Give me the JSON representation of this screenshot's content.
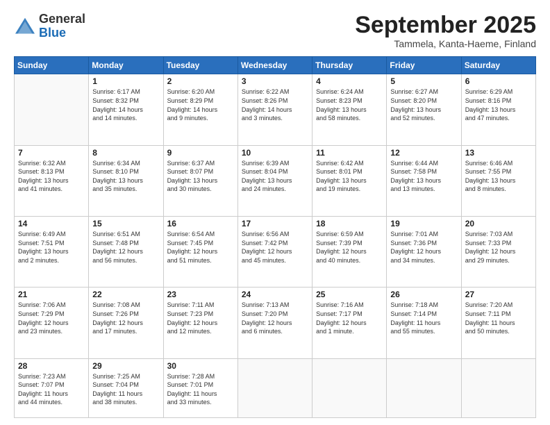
{
  "header": {
    "logo_general": "General",
    "logo_blue": "Blue",
    "month": "September 2025",
    "location": "Tammela, Kanta-Haeme, Finland"
  },
  "weekdays": [
    "Sunday",
    "Monday",
    "Tuesday",
    "Wednesday",
    "Thursday",
    "Friday",
    "Saturday"
  ],
  "weeks": [
    [
      {
        "day": "",
        "info": ""
      },
      {
        "day": "1",
        "info": "Sunrise: 6:17 AM\nSunset: 8:32 PM\nDaylight: 14 hours\nand 14 minutes."
      },
      {
        "day": "2",
        "info": "Sunrise: 6:20 AM\nSunset: 8:29 PM\nDaylight: 14 hours\nand 9 minutes."
      },
      {
        "day": "3",
        "info": "Sunrise: 6:22 AM\nSunset: 8:26 PM\nDaylight: 14 hours\nand 3 minutes."
      },
      {
        "day": "4",
        "info": "Sunrise: 6:24 AM\nSunset: 8:23 PM\nDaylight: 13 hours\nand 58 minutes."
      },
      {
        "day": "5",
        "info": "Sunrise: 6:27 AM\nSunset: 8:20 PM\nDaylight: 13 hours\nand 52 minutes."
      },
      {
        "day": "6",
        "info": "Sunrise: 6:29 AM\nSunset: 8:16 PM\nDaylight: 13 hours\nand 47 minutes."
      }
    ],
    [
      {
        "day": "7",
        "info": "Sunrise: 6:32 AM\nSunset: 8:13 PM\nDaylight: 13 hours\nand 41 minutes."
      },
      {
        "day": "8",
        "info": "Sunrise: 6:34 AM\nSunset: 8:10 PM\nDaylight: 13 hours\nand 35 minutes."
      },
      {
        "day": "9",
        "info": "Sunrise: 6:37 AM\nSunset: 8:07 PM\nDaylight: 13 hours\nand 30 minutes."
      },
      {
        "day": "10",
        "info": "Sunrise: 6:39 AM\nSunset: 8:04 PM\nDaylight: 13 hours\nand 24 minutes."
      },
      {
        "day": "11",
        "info": "Sunrise: 6:42 AM\nSunset: 8:01 PM\nDaylight: 13 hours\nand 19 minutes."
      },
      {
        "day": "12",
        "info": "Sunrise: 6:44 AM\nSunset: 7:58 PM\nDaylight: 13 hours\nand 13 minutes."
      },
      {
        "day": "13",
        "info": "Sunrise: 6:46 AM\nSunset: 7:55 PM\nDaylight: 13 hours\nand 8 minutes."
      }
    ],
    [
      {
        "day": "14",
        "info": "Sunrise: 6:49 AM\nSunset: 7:51 PM\nDaylight: 13 hours\nand 2 minutes."
      },
      {
        "day": "15",
        "info": "Sunrise: 6:51 AM\nSunset: 7:48 PM\nDaylight: 12 hours\nand 56 minutes."
      },
      {
        "day": "16",
        "info": "Sunrise: 6:54 AM\nSunset: 7:45 PM\nDaylight: 12 hours\nand 51 minutes."
      },
      {
        "day": "17",
        "info": "Sunrise: 6:56 AM\nSunset: 7:42 PM\nDaylight: 12 hours\nand 45 minutes."
      },
      {
        "day": "18",
        "info": "Sunrise: 6:59 AM\nSunset: 7:39 PM\nDaylight: 12 hours\nand 40 minutes."
      },
      {
        "day": "19",
        "info": "Sunrise: 7:01 AM\nSunset: 7:36 PM\nDaylight: 12 hours\nand 34 minutes."
      },
      {
        "day": "20",
        "info": "Sunrise: 7:03 AM\nSunset: 7:33 PM\nDaylight: 12 hours\nand 29 minutes."
      }
    ],
    [
      {
        "day": "21",
        "info": "Sunrise: 7:06 AM\nSunset: 7:29 PM\nDaylight: 12 hours\nand 23 minutes."
      },
      {
        "day": "22",
        "info": "Sunrise: 7:08 AM\nSunset: 7:26 PM\nDaylight: 12 hours\nand 17 minutes."
      },
      {
        "day": "23",
        "info": "Sunrise: 7:11 AM\nSunset: 7:23 PM\nDaylight: 12 hours\nand 12 minutes."
      },
      {
        "day": "24",
        "info": "Sunrise: 7:13 AM\nSunset: 7:20 PM\nDaylight: 12 hours\nand 6 minutes."
      },
      {
        "day": "25",
        "info": "Sunrise: 7:16 AM\nSunset: 7:17 PM\nDaylight: 12 hours\nand 1 minute."
      },
      {
        "day": "26",
        "info": "Sunrise: 7:18 AM\nSunset: 7:14 PM\nDaylight: 11 hours\nand 55 minutes."
      },
      {
        "day": "27",
        "info": "Sunrise: 7:20 AM\nSunset: 7:11 PM\nDaylight: 11 hours\nand 50 minutes."
      }
    ],
    [
      {
        "day": "28",
        "info": "Sunrise: 7:23 AM\nSunset: 7:07 PM\nDaylight: 11 hours\nand 44 minutes."
      },
      {
        "day": "29",
        "info": "Sunrise: 7:25 AM\nSunset: 7:04 PM\nDaylight: 11 hours\nand 38 minutes."
      },
      {
        "day": "30",
        "info": "Sunrise: 7:28 AM\nSunset: 7:01 PM\nDaylight: 11 hours\nand 33 minutes."
      },
      {
        "day": "",
        "info": ""
      },
      {
        "day": "",
        "info": ""
      },
      {
        "day": "",
        "info": ""
      },
      {
        "day": "",
        "info": ""
      }
    ]
  ]
}
